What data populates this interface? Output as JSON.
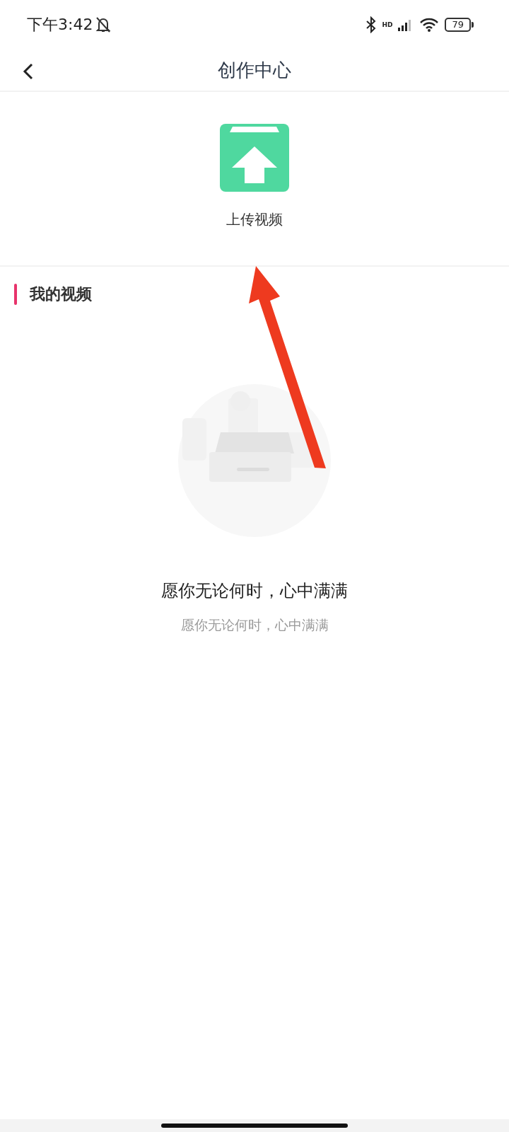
{
  "status_bar": {
    "time": "下午3:42",
    "network": "HD",
    "battery": "79"
  },
  "header": {
    "title": "创作中心"
  },
  "upload": {
    "label": "上传视频"
  },
  "section": {
    "title": "我的视频"
  },
  "empty_state": {
    "title": "愿你无论何时，心中满满",
    "subtitle": "愿你无论何时，心中满满"
  }
}
